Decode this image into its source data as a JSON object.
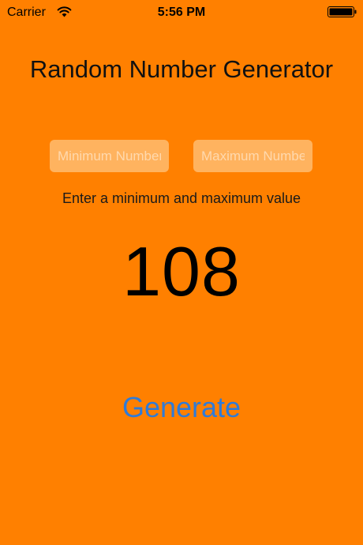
{
  "status_bar": {
    "carrier": "Carrier",
    "time": "5:56 PM",
    "wifi_icon": "wifi-icon",
    "battery_icon": "battery-icon"
  },
  "title": "Random Number Generator",
  "inputs": {
    "minimum": {
      "value": "",
      "placeholder": "Minimum Number"
    },
    "maximum": {
      "value": "",
      "placeholder": "Maximum Number"
    }
  },
  "instructions": "Enter a minimum and maximum value",
  "result": "108",
  "generate_label": "Generate",
  "colors": {
    "background": "#FF8000",
    "button_text": "#2F7BD8",
    "field_background": "#FFB35F"
  }
}
